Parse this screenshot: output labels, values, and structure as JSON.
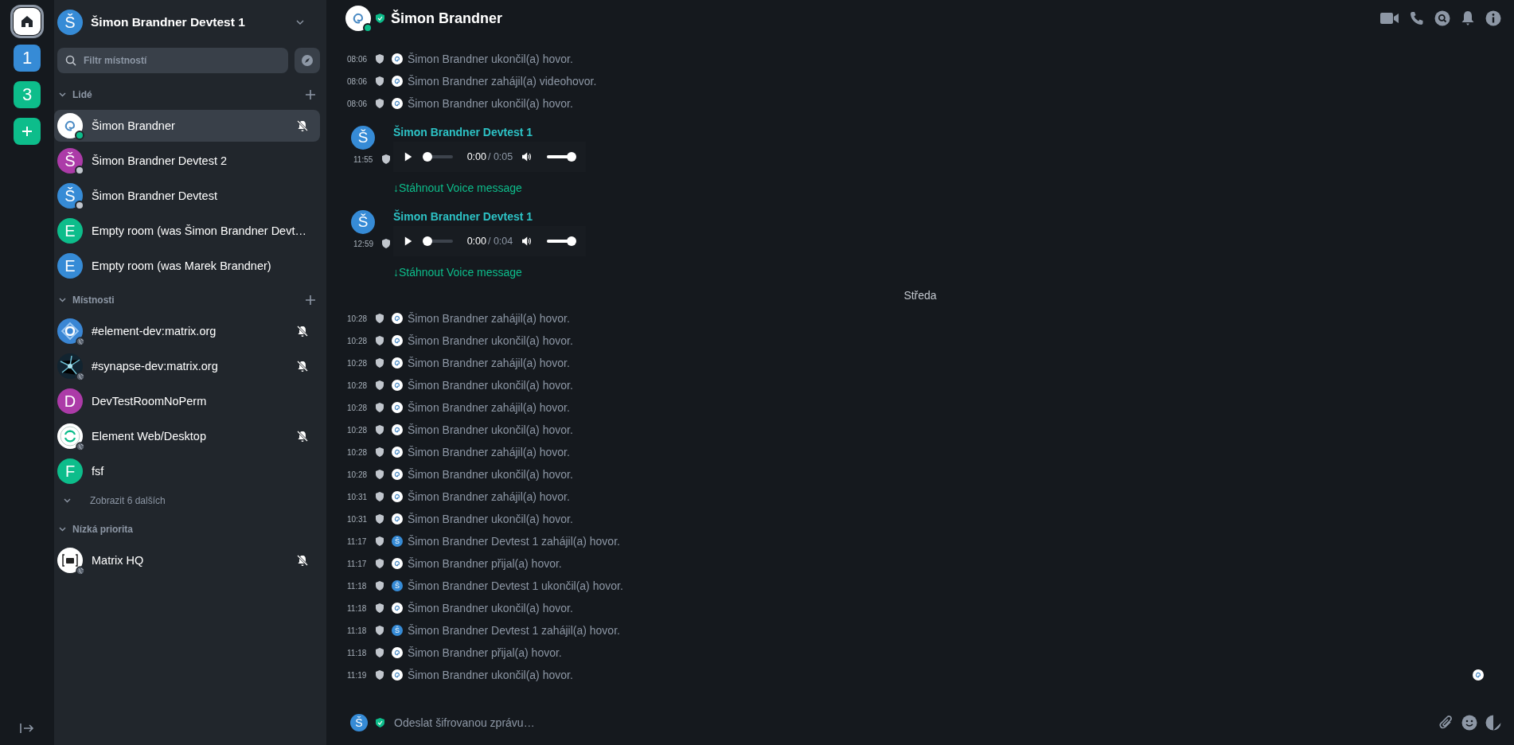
{
  "spaces": [
    {
      "kind": "home",
      "selected": true
    },
    {
      "kind": "letter",
      "label": "1",
      "color": "#368bd6",
      "selected": false
    },
    {
      "kind": "letter",
      "label": "3",
      "color": "#0dbd8b",
      "selected": false
    },
    {
      "kind": "add",
      "selected": false
    }
  ],
  "account": {
    "name": "Šimon Brandner Devtest 1",
    "letter": "Š",
    "color": "#368bd6"
  },
  "search": {
    "placeholder": "Filtr místností"
  },
  "sections": [
    {
      "title": "Lidé",
      "expanded": true,
      "can_add": true,
      "rooms": [
        {
          "name": "Šimon Brandner",
          "kind": "swirl",
          "online": true,
          "muted": true,
          "selected": true
        },
        {
          "name": "Šimon Brandner Devtest 2",
          "kind": "letter",
          "letter": "Š",
          "color": "#ac3ba8",
          "online": false,
          "muted": false,
          "selected": false
        },
        {
          "name": "Šimon Brandner Devtest",
          "kind": "letter",
          "letter": "Š",
          "color": "#368bd6",
          "online": false,
          "muted": false,
          "selected": false
        },
        {
          "name": "Empty room (was Šimon Brandner Devt…",
          "kind": "letter",
          "letter": "E",
          "color": "#0dbd8b",
          "muted": false,
          "selected": false
        },
        {
          "name": "Empty room (was Marek Brandner)",
          "kind": "letter",
          "letter": "E",
          "color": "#368bd6",
          "muted": false,
          "selected": false
        }
      ]
    },
    {
      "title": "Místnosti",
      "expanded": true,
      "can_add": true,
      "show_more": "Zobrazit 6 dalších",
      "rooms": [
        {
          "name": "#element-dev:matrix.org",
          "kind": "element",
          "public": true,
          "muted": true,
          "selected": false
        },
        {
          "name": "#synapse-dev:matrix.org",
          "kind": "network",
          "public": true,
          "muted": true,
          "selected": false
        },
        {
          "name": "DevTestRoomNoPerm",
          "kind": "letter",
          "letter": "D",
          "color": "#ac3ba8",
          "muted": false,
          "selected": false
        },
        {
          "name": "Element Web/Desktop",
          "kind": "elementweb",
          "public": true,
          "muted": true,
          "selected": false
        },
        {
          "name": "fsf",
          "kind": "letter",
          "letter": "F",
          "color": "#0dbd8b",
          "muted": false,
          "selected": false
        }
      ]
    },
    {
      "title": "Nízká priorita",
      "expanded": true,
      "can_add": false,
      "rooms": [
        {
          "name": "Matrix HQ",
          "kind": "matrix",
          "public": true,
          "muted": true,
          "selected": false
        }
      ]
    }
  ],
  "room": {
    "name": "Šimon Brandner",
    "online": true,
    "verified": true
  },
  "timeline": [
    {
      "kind": "event",
      "time": "08:06",
      "text": "Šimon Brandner ukončil(a) hovor."
    },
    {
      "kind": "event",
      "time": "08:06",
      "text": "Šimon Brandner zahájil(a) videohovor."
    },
    {
      "kind": "event",
      "time": "08:06",
      "text": "Šimon Brandner ukončil(a) hovor."
    },
    {
      "kind": "voice",
      "time": "11:55",
      "sender": "Šimon Brandner Devtest 1",
      "letter": "Š",
      "elapsed": "0:00",
      "duration": "/ 0:05",
      "level": 0,
      "volume": {
        "level": 1
      },
      "download": "↓Stáhnout Voice message"
    },
    {
      "kind": "voice",
      "time": "12:59",
      "sender": "Šimon Brandner Devtest 1",
      "letter": "Š",
      "elapsed": "0:00",
      "duration": "/ 0:04",
      "level": 0,
      "volume": {
        "level": 1
      },
      "download": "↓Stáhnout Voice message"
    },
    {
      "kind": "date",
      "label": "Středa"
    },
    {
      "kind": "event",
      "time": "10:28",
      "text": "Šimon Brandner zahájil(a) hovor."
    },
    {
      "kind": "event",
      "time": "10:28",
      "text": "Šimon Brandner ukončil(a) hovor."
    },
    {
      "kind": "event",
      "time": "10:28",
      "text": "Šimon Brandner zahájil(a) hovor."
    },
    {
      "kind": "event",
      "time": "10:28",
      "text": "Šimon Brandner ukončil(a) hovor."
    },
    {
      "kind": "event",
      "time": "10:28",
      "text": "Šimon Brandner zahájil(a) hovor."
    },
    {
      "kind": "event",
      "time": "10:28",
      "text": "Šimon Brandner ukončil(a) hovor."
    },
    {
      "kind": "event",
      "time": "10:28",
      "text": "Šimon Brandner zahájil(a) hovor."
    },
    {
      "kind": "event",
      "time": "10:28",
      "text": "Šimon Brandner ukončil(a) hovor."
    },
    {
      "kind": "event",
      "time": "10:31",
      "text": "Šimon Brandner zahájil(a) hovor."
    },
    {
      "kind": "event",
      "time": "10:31",
      "text": "Šimon Brandner ukončil(a) hovor."
    },
    {
      "kind": "event",
      "time": "11:17",
      "letter": "Š",
      "text": "Šimon Brandner Devtest 1 zahájil(a) hovor."
    },
    {
      "kind": "event",
      "time": "11:17",
      "text": "Šimon Brandner přijal(a) hovor."
    },
    {
      "kind": "event",
      "time": "11:18",
      "letter": "Š",
      "text": "Šimon Brandner Devtest 1 ukončil(a) hovor."
    },
    {
      "kind": "event",
      "time": "11:18",
      "text": "Šimon Brandner ukončil(a) hovor."
    },
    {
      "kind": "event",
      "time": "11:18",
      "letter": "Š",
      "text": "Šimon Brandner Devtest 1 zahájil(a) hovor."
    },
    {
      "kind": "event",
      "time": "11:18",
      "text": "Šimon Brandner přijal(a) hovor."
    },
    {
      "kind": "event",
      "time": "11:19",
      "text": "Šimon Brandner ukončil(a) hovor.",
      "read_receipt": true
    }
  ],
  "composer": {
    "letter": "Š",
    "placeholder": "Odeslat šifrovanou zprávu…",
    "encrypted": true
  }
}
